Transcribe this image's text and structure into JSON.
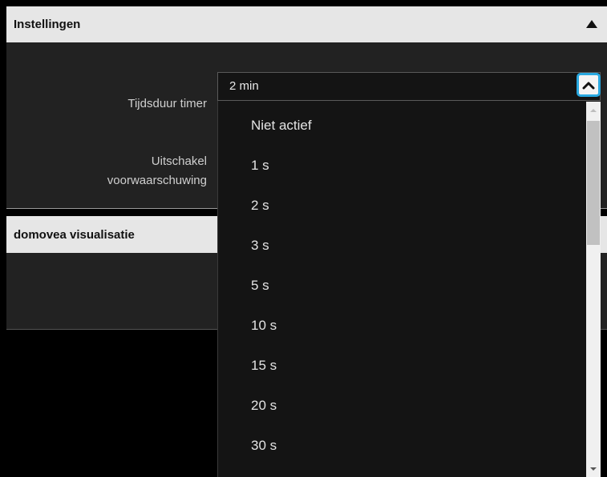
{
  "settings_section": {
    "title": "Instellingen",
    "collapse_icon": "triangle-up-icon"
  },
  "fields": {
    "timer_duration_label": "Tijdsduur timer",
    "shutdown_warning_label_line1": "Uitschakel",
    "shutdown_warning_label_line2": "voorwaarschuwing"
  },
  "dropdown": {
    "selected_value": "2 min",
    "toggle_icon": "chevron-up-icon",
    "options": [
      "Niet actief",
      "1 s",
      "2 s",
      "3 s",
      "5 s",
      "10 s",
      "15 s",
      "20 s",
      "30 s"
    ]
  },
  "visualization_section": {
    "title": "domovea visualisatie"
  },
  "colors": {
    "focus_accent": "#29a8e0",
    "header_bg": "#e6e6e6",
    "panel_bg": "#222222",
    "dropdown_bg": "#141414"
  }
}
